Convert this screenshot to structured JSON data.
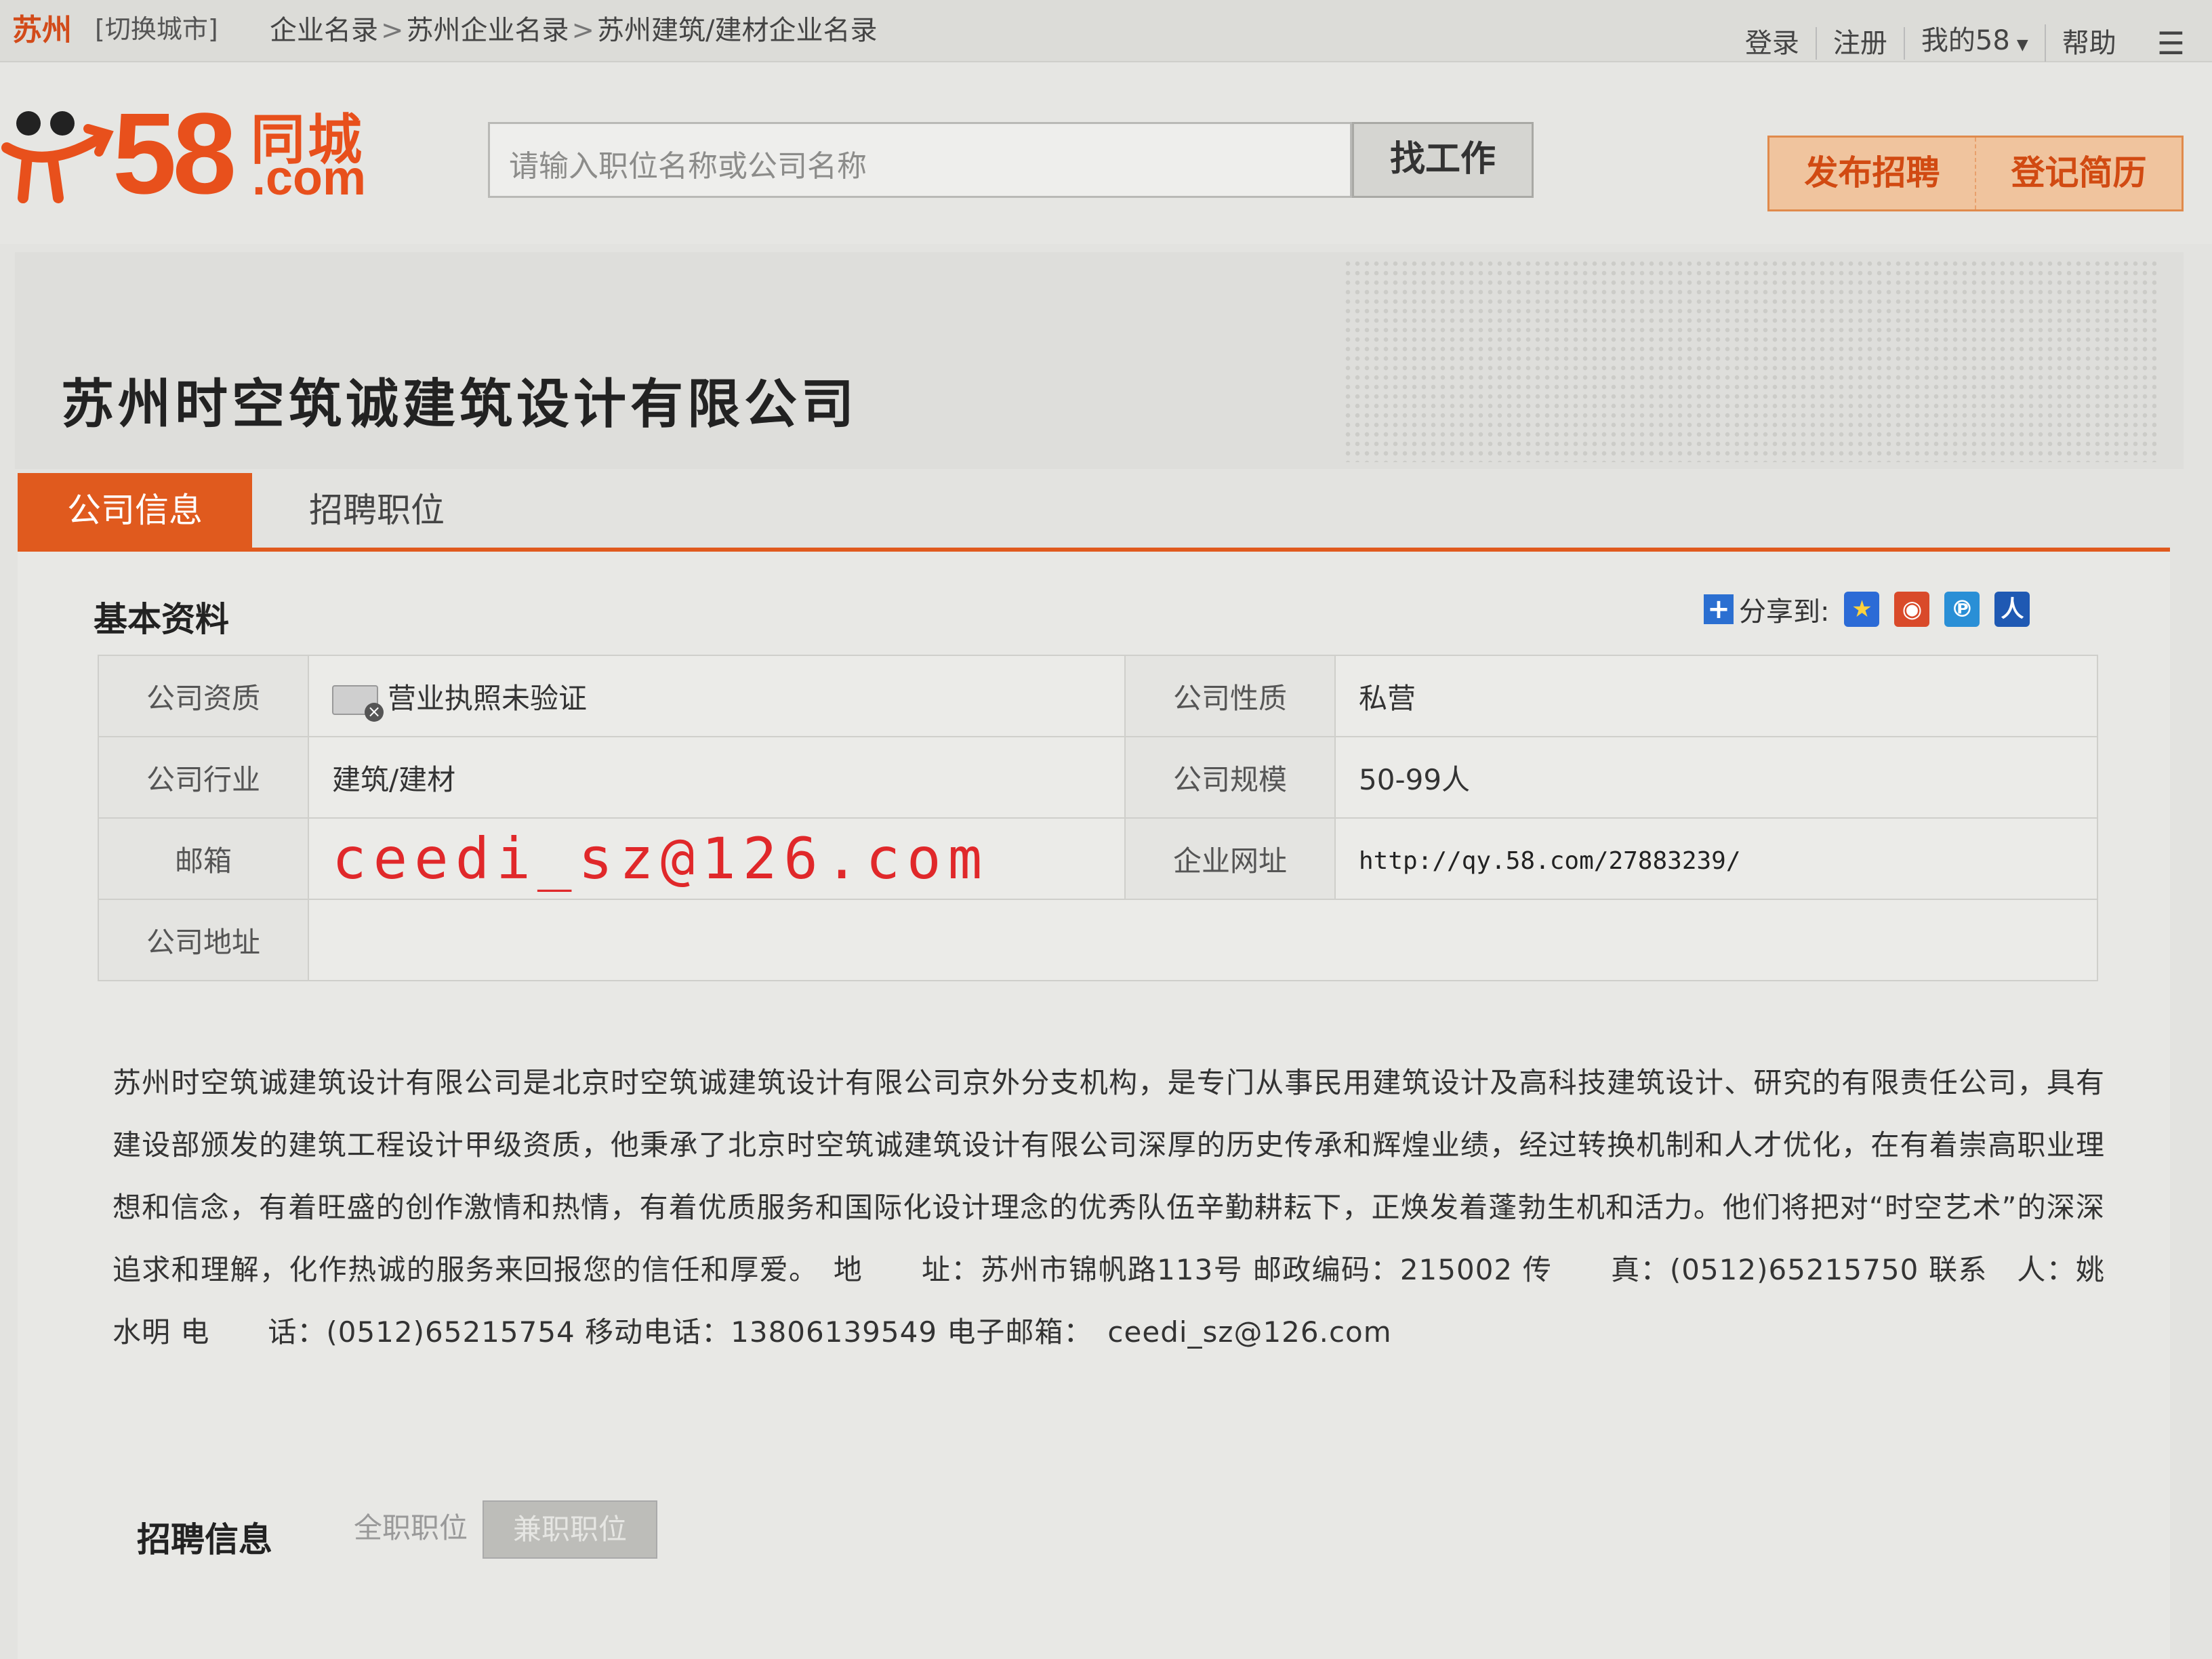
{
  "topbar": {
    "city": "苏州",
    "switch_city": "[切换城市]",
    "breadcrumb": [
      "企业名录",
      "苏州企业名录",
      "苏州建筑/建材企业名录"
    ],
    "breadcrumb_sep": ">",
    "links": {
      "login": "登录",
      "register": "注册",
      "my58": "我的58",
      "help": "帮助"
    }
  },
  "header": {
    "logo": {
      "number": "58",
      "cn": "同城",
      "com": ".com"
    },
    "search": {
      "placeholder": "请输入职位名称或公司名称",
      "button": "找工作"
    },
    "actions": {
      "post_job": "发布招聘",
      "register_resume": "登记简历"
    }
  },
  "company": {
    "name": "苏州时空筑诚建筑设计有限公司"
  },
  "tabs": {
    "company_info": "公司信息",
    "jobs": "招聘职位"
  },
  "basic": {
    "title": "基本资料",
    "share_label": "分享到:",
    "share_icons": [
      "qzone-icon",
      "weibo-icon",
      "tencent-weibo-icon",
      "renren-icon"
    ],
    "rows": {
      "qualification": {
        "label": "公司资质",
        "value": "营业执照未验证"
      },
      "nature": {
        "label": "公司性质",
        "value": "私营"
      },
      "industry": {
        "label": "公司行业",
        "value": "建筑/建材"
      },
      "scale": {
        "label": "公司规模",
        "value": "50-99人"
      },
      "email": {
        "label": "邮箱",
        "value": "ceedi_sz@126.com"
      },
      "website": {
        "label": "企业网址",
        "value": "http://qy.58.com/27883239/"
      },
      "address": {
        "label": "公司地址",
        "value": ""
      }
    }
  },
  "description": "苏州时空筑诚建筑设计有限公司是北京时空筑诚建筑设计有限公司京外分支机构，是专门从事民用建筑设计及高科技建筑设计、研究的有限责任公司，具有建设部颁发的建筑工程设计甲级资质，他秉承了北京时空筑诚建筑设计有限公司深厚的历史传承和辉煌业绩，经过转换机制和人才优化，在有着崇高职业理想和信念，有着旺盛的创作激情和热情，有着优质服务和国际化设计理念的优秀队伍辛勤耕耘下，正焕发着蓬勃生机和活力。他们将把对“时空艺术”的深深追求和理解，化作热诚的服务来回报您的信任和厚爱。　地　　址：苏州市锦帆路113号 邮政编码：215002 传　　真：(0512)65215750 联系　人：姚水明 电　　话：(0512)65215754 移动电话：13806139549 电子邮箱：　ceedi_sz@126.com",
  "recruit": {
    "title": "招聘信息",
    "full_time": "全职职位",
    "part_time": "兼职职位"
  },
  "colors": {
    "brand": "#e8501c",
    "tab_active": "#e05a1e",
    "email_red": "#e0282a"
  }
}
